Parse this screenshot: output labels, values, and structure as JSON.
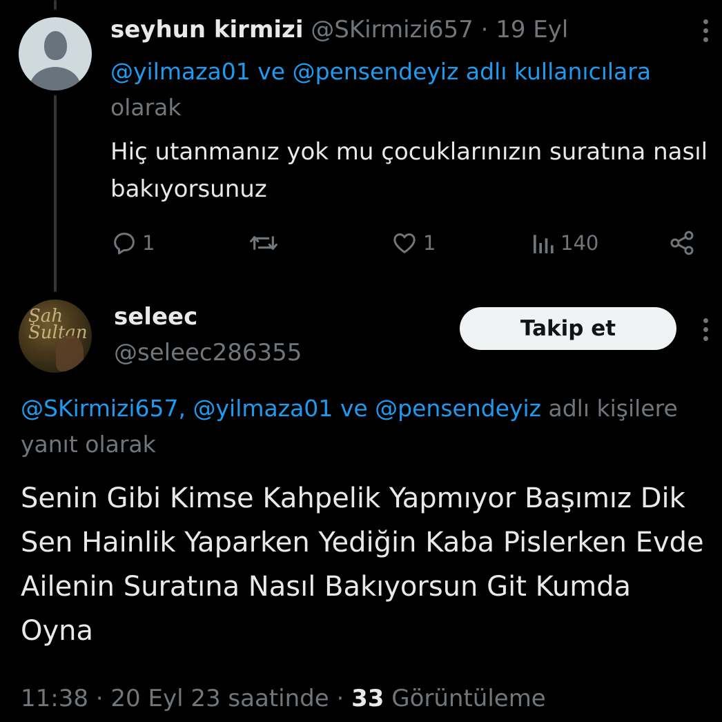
{
  "tweet1": {
    "display_name": "seyhun kirmizi",
    "handle": "@SKirmizi657",
    "separator": "·",
    "date": "19 Eyl",
    "reply_to_mentions": "@yilmaza01 ve @pensendeyiz adlı kullanıcılara",
    "reply_to_suffix": "olarak",
    "body": "Hiç utanmanız yok mu çocuklarınızın suratına nasıl bakıyorsunuz",
    "reply_count": "1",
    "like_count": "1",
    "view_count": "140",
    "icons": [
      "reply-icon",
      "retweet-icon",
      "like-icon",
      "views-icon",
      "share-icon",
      "more-icon"
    ]
  },
  "tweet2": {
    "display_name": "seleec",
    "handle": "@seleec286355",
    "avatar_text": "Şah Sultan",
    "follow_label": "Takip et",
    "reply_to": {
      "mention1": "@SKirmizi657,",
      "mention2": "@yilmaza01",
      "conj": "ve",
      "mention3": "@pensendeyiz",
      "suffix_a": "adlı",
      "suffix_b": "kişilere yanıt olarak"
    },
    "body": "Senin Gibi Kimse Kahpelik Yapmıyor Başımız Dik Sen Hainlik Yaparken Yediğin Kaba Pislerken Evde Ailenin Suratına Nasıl Bakıyorsun Git Kumda Oyna",
    "time": "11:38",
    "date": "20 Eyl 23 saatinde",
    "separator": "·",
    "views_count": "33",
    "views_label": "Görüntüleme"
  },
  "colors": {
    "background": "#000000",
    "text": "#e7e9ea",
    "muted": "#71767b",
    "link": "#1d9bf0",
    "follow_button_bg": "#eff3f4",
    "thread_line": "#333639"
  }
}
